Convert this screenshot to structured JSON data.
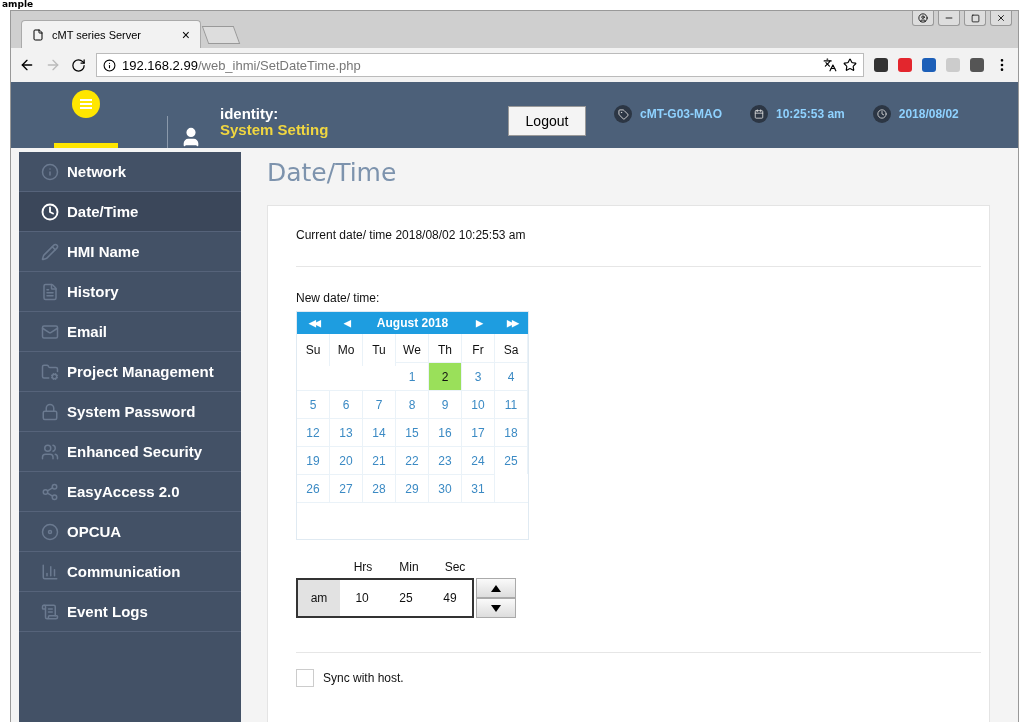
{
  "top_caption": "ample",
  "browser": {
    "tab_title": "cMT series Server",
    "tab_close": "×",
    "url_host": "192.168.2.99",
    "url_path": "/web_ihmi/SetDateTime.php"
  },
  "header": {
    "identity_label": "identity:",
    "identity_value": "System Setting",
    "logout": "Logout",
    "device": "cMT-G03-MAO",
    "time": "10:25:53 am",
    "date": "2018/08/02"
  },
  "sidebar": {
    "items": [
      {
        "label": "Network",
        "selected": false
      },
      {
        "label": "Date/Time",
        "selected": true
      },
      {
        "label": "HMI Name",
        "selected": false
      },
      {
        "label": "History",
        "selected": false
      },
      {
        "label": "Email",
        "selected": false
      },
      {
        "label": "Project Management",
        "selected": false
      },
      {
        "label": "System Password",
        "selected": false
      },
      {
        "label": "Enhanced Security",
        "selected": false
      },
      {
        "label": "EasyAccess 2.0",
        "selected": false
      },
      {
        "label": "OPCUA",
        "selected": false
      },
      {
        "label": "Communication",
        "selected": false
      },
      {
        "label": "Event Logs",
        "selected": false
      }
    ]
  },
  "page_title": "Date/Time",
  "current": "Current date/ time 2018/08/02 10:25:53 am",
  "new_label": "New date/ time:",
  "calendar": {
    "nav": [
      "◀◀",
      "◀",
      "▶",
      "▶▶"
    ],
    "month": "August 2018",
    "weekdays": [
      "Su",
      "Mo",
      "Tu",
      "We",
      "Th",
      "Fr",
      "Sa"
    ],
    "weeks": [
      [
        {
          "day": "1",
          "selected": false
        },
        {
          "day": "2",
          "selected": true
        },
        {
          "day": "3",
          "selected": false
        },
        {
          "day": "4",
          "selected": false
        }
      ],
      [
        {
          "day": "5",
          "selected": false
        },
        {
          "day": "6",
          "selected": false
        },
        {
          "day": "7",
          "selected": false
        },
        {
          "day": "8",
          "selected": false
        },
        {
          "day": "9",
          "selected": false
        },
        {
          "day": "10",
          "selected": false
        },
        {
          "day": "11",
          "selected": false
        }
      ],
      [
        {
          "day": "12",
          "selected": false
        },
        {
          "day": "13",
          "selected": false
        },
        {
          "day": "14",
          "selected": false
        },
        {
          "day": "15",
          "selected": false
        },
        {
          "day": "16",
          "selected": false
        },
        {
          "day": "17",
          "selected": false
        },
        {
          "day": "18",
          "selected": false
        }
      ],
      [
        {
          "day": "19",
          "selected": false
        },
        {
          "day": "20",
          "selected": false
        },
        {
          "day": "21",
          "selected": false
        },
        {
          "day": "22",
          "selected": false
        },
        {
          "day": "23",
          "selected": false
        },
        {
          "day": "24",
          "selected": false
        },
        {
          "day": "25",
          "selected": false
        }
      ],
      [
        {
          "day": "26",
          "selected": false
        },
        {
          "day": "27",
          "selected": false
        },
        {
          "day": "28",
          "selected": false
        },
        {
          "day": "29",
          "selected": false
        },
        {
          "day": "30",
          "selected": false
        },
        {
          "day": "31",
          "selected": false
        }
      ]
    ]
  },
  "time": {
    "labels": [
      "Hrs",
      "Min",
      "Sec"
    ],
    "ampm": "am",
    "values": [
      "10",
      "25",
      "49"
    ]
  },
  "sync": {
    "label": "Sync with host.",
    "checked": false
  }
}
